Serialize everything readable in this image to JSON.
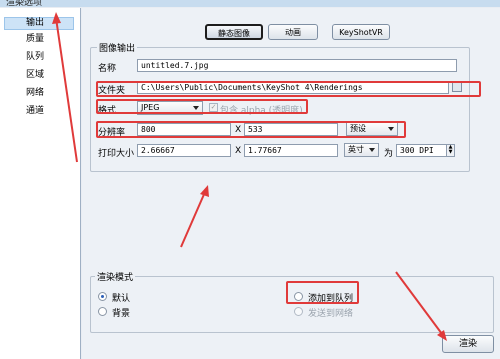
{
  "window": {
    "title": "渲染选项"
  },
  "sidebar": {
    "items": [
      {
        "label": "输出"
      },
      {
        "label": "质量"
      },
      {
        "label": "队列"
      },
      {
        "label": "区域"
      },
      {
        "label": "网络"
      },
      {
        "label": "通道"
      }
    ]
  },
  "tabs": {
    "still": "静态图像",
    "animation": "动画",
    "keyshotvr": "KeyShotVR"
  },
  "image_output": {
    "legend": "图像输出",
    "name_label": "名称",
    "name_value": "untitled.7.jpg",
    "folder_label": "文件夹",
    "folder_value": "C:\\Users\\Public\\Documents\\KeyShot 4\\Renderings",
    "format_label": "格式",
    "format_value": "JPEG",
    "alpha_label": "包含 alpha (透明度)",
    "resolution_label": "分辨率",
    "res_width": "800",
    "x_label": "X",
    "res_height": "533",
    "preset_label": "预设",
    "print_size_label": "打印大小",
    "print_width": "2.66667",
    "print_height": "1.77667",
    "unit_value": "英寸",
    "for_label": "为",
    "dpi_value": "300 DPI"
  },
  "render_mode": {
    "legend": "渲染模式",
    "default_label": "默认",
    "background_label": "背景",
    "add_queue_label": "添加到队列",
    "send_network_label": "发送到网络"
  },
  "footer": {
    "render_button": "渲染"
  },
  "colors": {
    "annotation_red": "#e03a3a",
    "selection_blue": "#cde3f7"
  }
}
